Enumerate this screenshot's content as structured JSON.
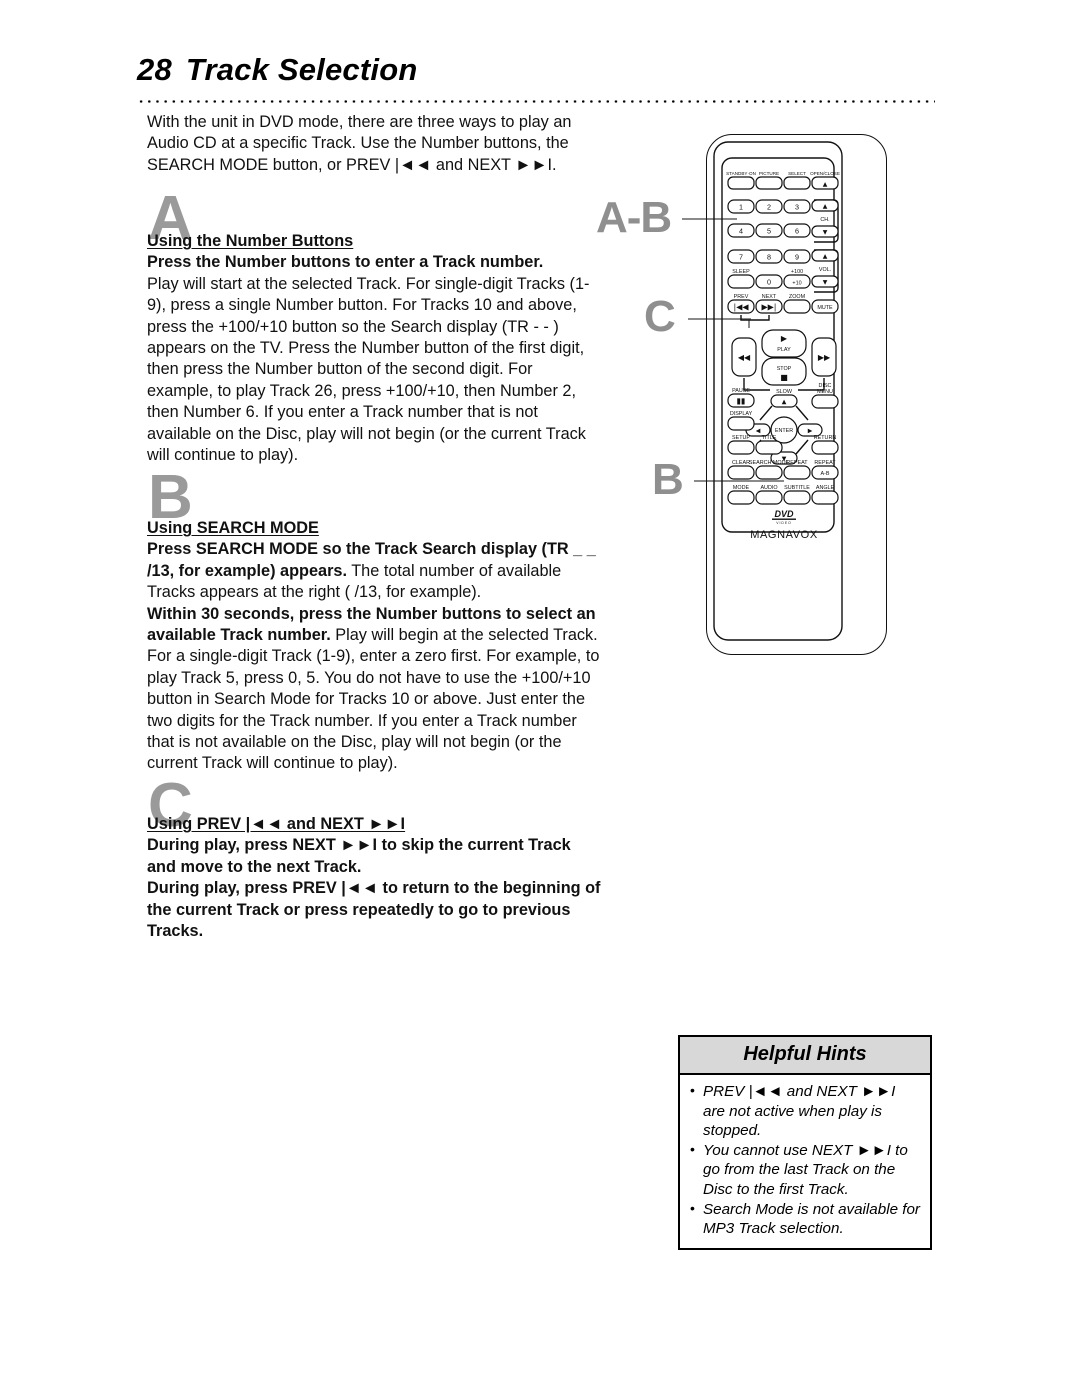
{
  "page": {
    "number": "28",
    "title": "Track Selection"
  },
  "intro": "With the unit in DVD mode, there are three ways to play an Audio CD at a specific Track. Use the Number buttons, the SEARCH MODE button, or PREV |◄◄ and NEXT ►►I.",
  "sections": [
    {
      "letter": "A",
      "heading": "Using the Number Buttons",
      "lead": "Press the Number buttons to enter a Track number.",
      "body": "Play will start at the selected Track. For single-digit Tracks (1-9), press a single Number button. For Tracks 10 and above, press the +100/+10 button so the Search display (TR - - ) appears on the TV. Press the Number button of the first digit, then press the Number button of the second digit. For example, to play Track 26, press +100/+10, then Number 2, then Number 6. If you enter a Track number that is not available on the Disc, play will not begin (or the current Track will continue to play)."
    },
    {
      "letter": "B",
      "heading": "Using SEARCH MODE",
      "lead": "Press SEARCH MODE so the Track Search display (TR _ _ /13, for example) appears.",
      "body_1": "The total number of available Tracks appears at the right (  /13, for example).",
      "lead_2": "Within 30 seconds, press the Number buttons to select an available Track number.",
      "body_2": "Play will begin at the selected Track. For a single-digit Track (1-9), enter a zero first. For example, to play Track 5, press 0, 5. You do not have to use the +100/+10 button in Search Mode for Tracks 10 or above. Just enter the two digits for the Track number. If you enter a Track number that is not available on the Disc, play will not begin (or the current Track will continue to play)."
    },
    {
      "letter": "C",
      "heading": "Using PREV |◄◄ and NEXT ►►I",
      "lead_1": "During play, press NEXT ►►I to skip the current Track and move to the next Track.",
      "lead_2": "During play, press PREV |◄◄ to return to the beginning of the current Track or press repeatedly to go to previous Tracks."
    }
  ],
  "callouts": [
    {
      "label": "A-B",
      "target": "number-buttons"
    },
    {
      "label": "C",
      "target": "prev-next-buttons"
    },
    {
      "label": "B",
      "target": "search-mode-button"
    }
  ],
  "remote": {
    "brand": "MAGNAVOX",
    "logo": "DVD",
    "logo_sub": "VIDEO",
    "rows": {
      "top": [
        "STANDBY·ON",
        "PICTURE",
        "SELECT",
        "OPEN/CLOSE"
      ],
      "numbers": [
        "1",
        "2",
        "3",
        "4",
        "5",
        "6",
        "7",
        "8",
        "9",
        "0"
      ],
      "sleep": "SLEEP",
      "plus100": "+100",
      "plus10": "+10",
      "ch": "CH.",
      "vol": "VOL.",
      "prev": "PREV",
      "next": "NEXT",
      "zoom": "ZOOM",
      "mute": "MUTE",
      "play": "PLAY",
      "stop": "STOP",
      "slow": "SLOW",
      "pause": "PAUSE",
      "disc_menu_1": "DISC",
      "disc_menu_2": "MENU",
      "display": "DISPLAY",
      "enter": "ENTER",
      "setup": "SETUP",
      "title": "TITLE",
      "return": "RETURN",
      "clear": "CLEAR",
      "search_mode": "SEARCH MODE",
      "repeat": "REPEAT",
      "repeat_ab_1": "REPEAT",
      "repeat_ab_2": "A-B",
      "mode": "MODE",
      "audio": "AUDIO",
      "subtitle": "SUBTITLE",
      "angle": "ANGLE"
    }
  },
  "hints": {
    "title": "Helpful Hints",
    "items": [
      "PREV |◄◄ and  NEXT ►►I are not active when play is stopped.",
      "You cannot use NEXT ►►I to go from the last Track on the Disc to the first Track.",
      "Search Mode is not available for MP3 Track selection."
    ]
  },
  "colors": {
    "letter_grey": "#9a9a9a",
    "hint_header_bg": "#d8d8d8",
    "ink": "#000000"
  }
}
